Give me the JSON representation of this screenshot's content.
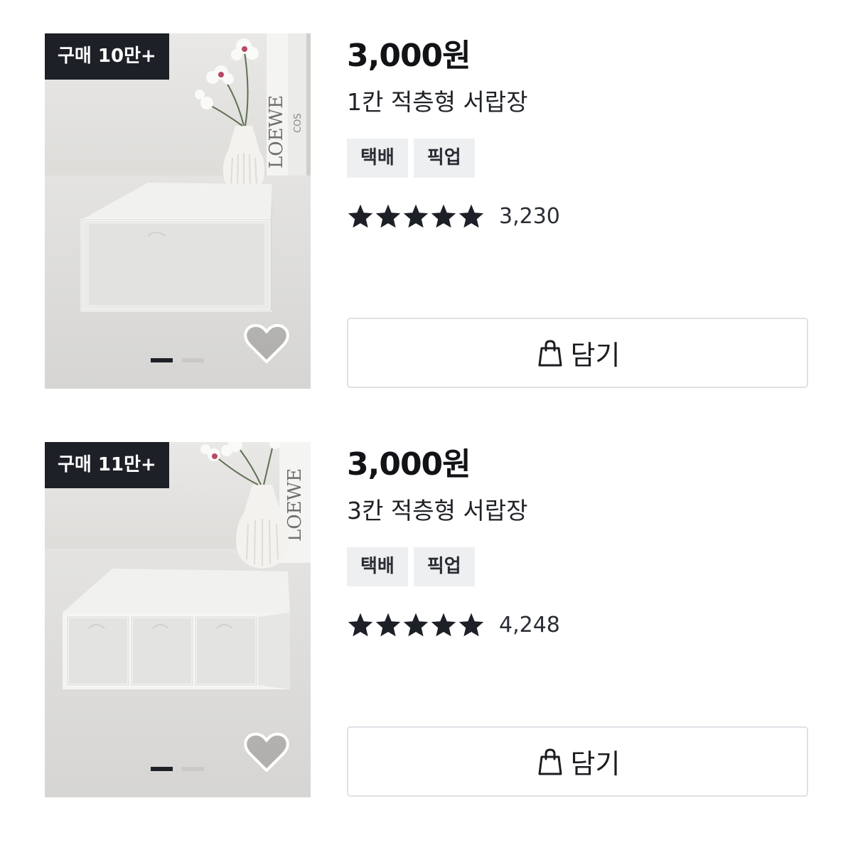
{
  "products": [
    {
      "badge": "구매 10만+",
      "price": "3,000원",
      "title": "1칸 적층형 서랍장",
      "tags": [
        "택배",
        "픽업"
      ],
      "rating": 5,
      "review_count": "3,230",
      "cart_label": "담기",
      "image_indicator": {
        "total": 2,
        "active": 0
      },
      "drawer_count": 1
    },
    {
      "badge": "구매 11만+",
      "price": "3,000원",
      "title": "3칸 적층형 서랍장",
      "tags": [
        "택배",
        "픽업"
      ],
      "rating": 5,
      "review_count": "4,248",
      "cart_label": "담기",
      "image_indicator": {
        "total": 2,
        "active": 0
      },
      "drawer_count": 3
    }
  ],
  "icons": {
    "wishlist": "heart-outline-icon",
    "cart": "shopping-bag-icon",
    "rating": "star-icon"
  },
  "colors": {
    "badge_bg": "#1d2026",
    "star": "#1d2026",
    "tag_bg": "#eeeff1",
    "button_border": "#dfe1e5"
  }
}
